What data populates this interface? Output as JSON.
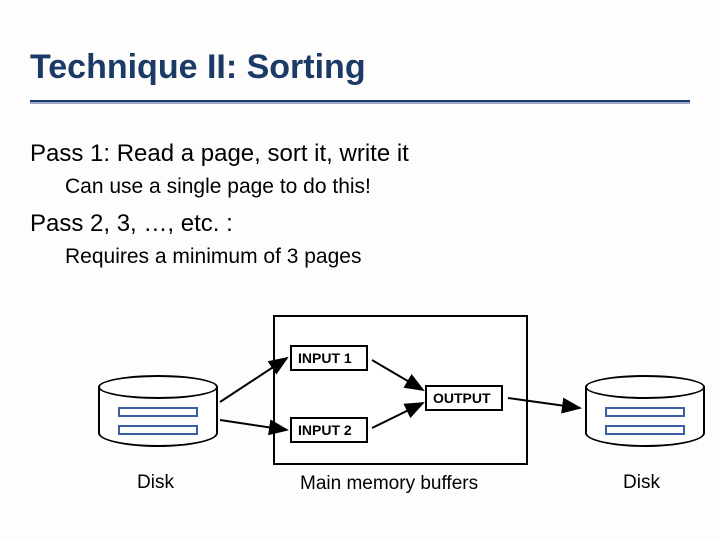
{
  "title": "Technique II:  Sorting",
  "pass1": {
    "heading": "Pass 1: Read a page, sort it, write it",
    "sub": "Can use a single page to do this!"
  },
  "pass2": {
    "heading": "Pass 2, 3, …, etc. :",
    "sub": "Requires a minimum of 3 pages"
  },
  "diagram": {
    "left_disk_label": "Disk",
    "right_disk_label": "Disk",
    "memory_label": "Main memory buffers",
    "buffers": {
      "input1": "INPUT 1",
      "input2": "INPUT 2",
      "output": "OUTPUT"
    }
  }
}
